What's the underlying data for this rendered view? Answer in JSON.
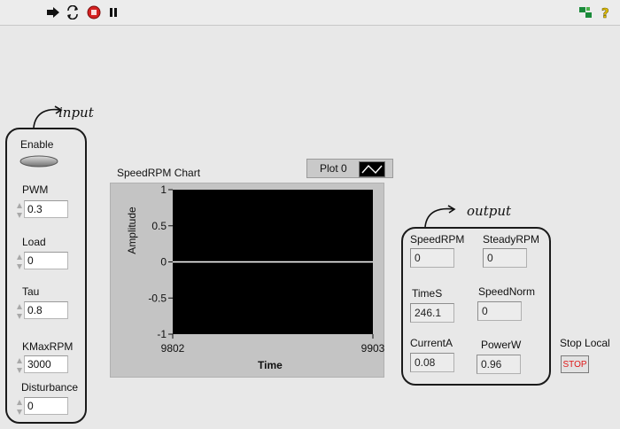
{
  "toolbar": {
    "run_icon": "run-arrow-icon",
    "continuous_icon": "run-continuously-icon",
    "abort_icon": "abort-icon",
    "pause_icon": "pause-icon",
    "context_help_icon": "context-help-icon",
    "help_icon": "help-icon"
  },
  "annotations": {
    "input_label": "input",
    "output_label": "output"
  },
  "controls": {
    "enable": {
      "label": "Enable",
      "state": false
    },
    "pwm": {
      "label": "PWM",
      "value": "0.3"
    },
    "load": {
      "label": "Load",
      "value": "0"
    },
    "tau": {
      "label": "Tau",
      "value": "0.8"
    },
    "kmax": {
      "label": "KMaxRPM",
      "value": "3000"
    },
    "disturbance": {
      "label": "Disturbance",
      "value": "0"
    }
  },
  "chart": {
    "title": "SpeedRPM Chart",
    "legend_label": "Plot 0",
    "xlabel": "Time",
    "ylabel": "Amplitude",
    "ytick_labels": [
      "1",
      "0.5",
      "0",
      "-0.5",
      "-1"
    ],
    "xtick_labels": [
      "9802",
      "9903"
    ]
  },
  "chart_data": {
    "type": "line",
    "title": "SpeedRPM Chart",
    "xlabel": "Time",
    "ylabel": "Amplitude",
    "xlim": [
      9802,
      9903
    ],
    "ylim": [
      -1,
      1
    ],
    "yticks": [
      1,
      0.5,
      0,
      -0.5,
      -1
    ],
    "xticks": [
      9802,
      9903
    ],
    "grid": false,
    "legend": "top-right",
    "series": [
      {
        "name": "Plot 0",
        "x": [
          9802,
          9903
        ],
        "values": [
          0,
          0
        ]
      }
    ]
  },
  "indicators": {
    "speedrpm": {
      "label": "SpeedRPM",
      "value": "0"
    },
    "steadyrpm": {
      "label": "SteadyRPM",
      "value": "0"
    },
    "times": {
      "label": "TimeS",
      "value": "246.1"
    },
    "speednorm": {
      "label": "SpeedNorm",
      "value": "0"
    },
    "currenta": {
      "label": "CurrentA",
      "value": "0.08"
    },
    "powerw": {
      "label": "PowerW",
      "value": "0.96"
    }
  },
  "stop": {
    "label": "Stop Local",
    "button_text": "STOP"
  },
  "colors": {
    "plot_bg": "#000000",
    "trace": "#ffffff",
    "stop_text": "#e01818",
    "panel_bg": "#e8e8e8"
  }
}
